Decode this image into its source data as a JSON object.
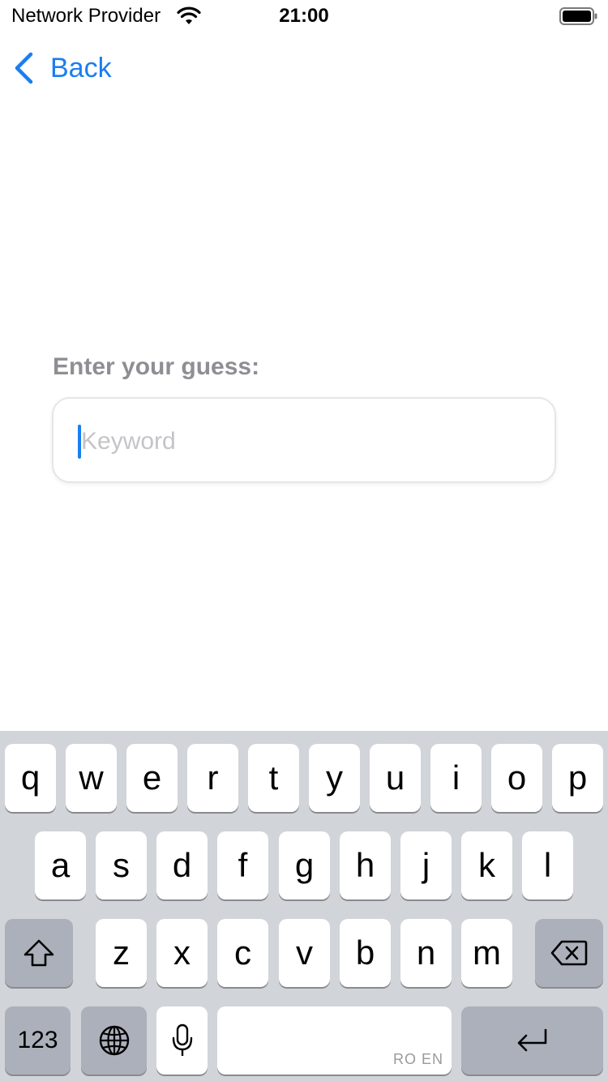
{
  "status_bar": {
    "carrier": "Network Provider",
    "time": "21:00"
  },
  "nav": {
    "back_label": "Back"
  },
  "prompt": {
    "label": "Enter your guess:"
  },
  "guess_input": {
    "placeholder": "Keyword",
    "value": ""
  },
  "keyboard": {
    "row1": [
      "q",
      "w",
      "e",
      "r",
      "t",
      "y",
      "u",
      "i",
      "o",
      "p"
    ],
    "row2": [
      "a",
      "s",
      "d",
      "f",
      "g",
      "h",
      "j",
      "k",
      "l"
    ],
    "row3": [
      "z",
      "x",
      "c",
      "v",
      "b",
      "n",
      "m"
    ],
    "numbers_label": "123",
    "space_hint": "RO EN"
  },
  "colors": {
    "accent": "#1a7ef0",
    "keyboard_bg": "#d1d4d9",
    "special_key": "#abb0ba"
  }
}
